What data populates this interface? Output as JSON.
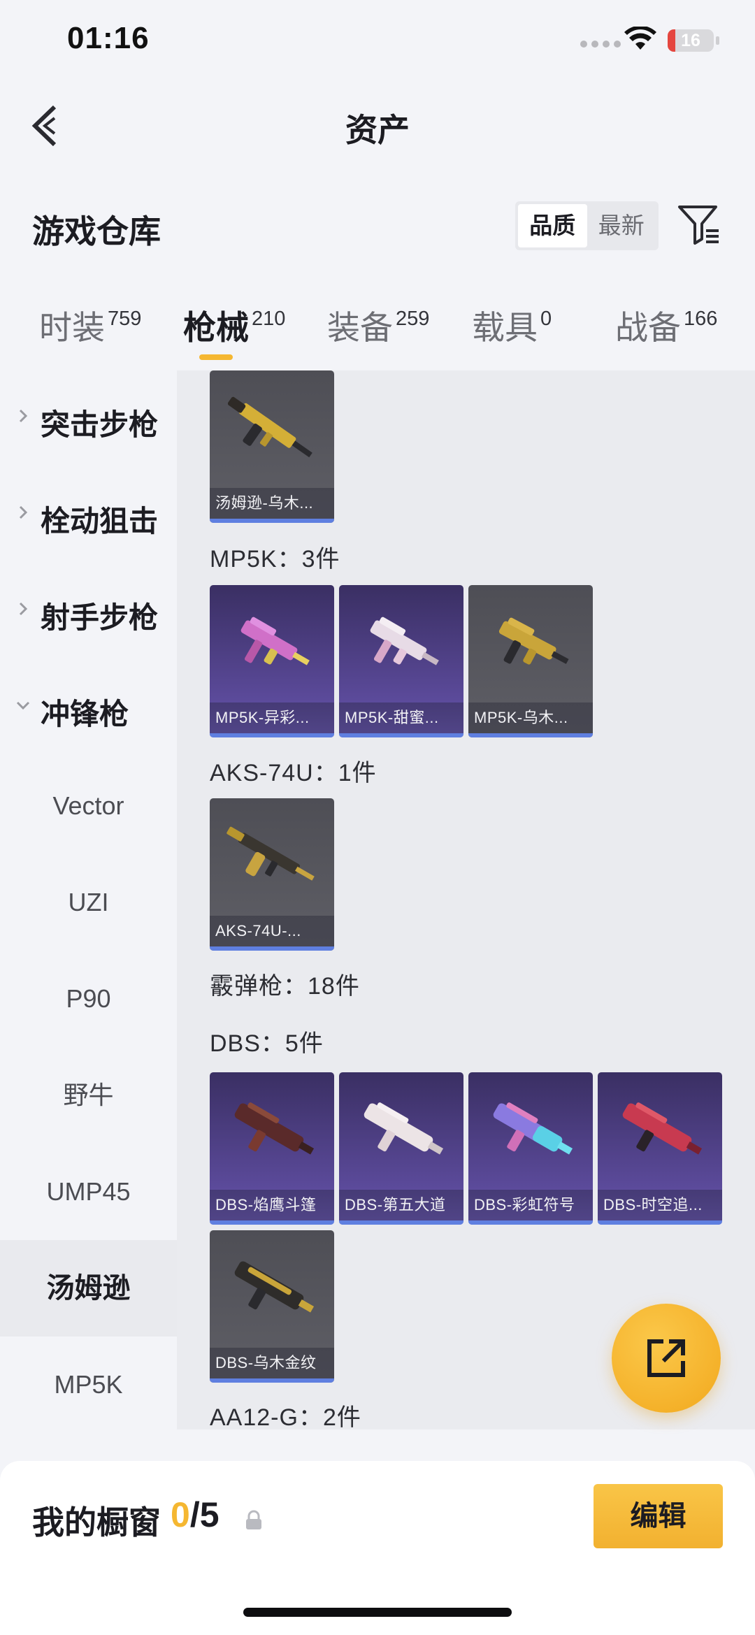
{
  "status_bar": {
    "time": "01:16",
    "battery": "16",
    "battery_level": 0.16,
    "battery_color": "#e5463f"
  },
  "nav": {
    "title": "资产"
  },
  "header": {
    "title": "游戏仓库",
    "sort_options": [
      "品质",
      "最新"
    ],
    "active_sort": "品质"
  },
  "category_tabs": [
    {
      "label": "时装",
      "count": "759",
      "active": false
    },
    {
      "label": "枪械",
      "count": "210",
      "active": true
    },
    {
      "label": "装备",
      "count": "259",
      "active": false
    },
    {
      "label": "载具",
      "count": "0",
      "active": false
    },
    {
      "label": "战备",
      "count": "166",
      "active": false
    }
  ],
  "sidebar": {
    "groups": [
      {
        "label": "突击步枪",
        "expanded": false
      },
      {
        "label": "栓动狙击",
        "expanded": false
      },
      {
        "label": "射手步枪",
        "expanded": false
      },
      {
        "label": "冲锋枪",
        "expanded": true
      }
    ],
    "sub_items": [
      "Vector",
      "UZI",
      "P90",
      "野牛",
      "UMP45",
      "汤姆逊",
      "MP5K"
    ],
    "selected_sub_item": "汤姆逊"
  },
  "content": {
    "sections": [
      {
        "label": "",
        "items": [
          {
            "name": "汤姆逊-乌木...",
            "tint": "gray"
          }
        ]
      },
      {
        "label": "MP5K：3件",
        "items": [
          {
            "name": "MP5K-异彩...",
            "tint": "purple"
          },
          {
            "name": "MP5K-甜蜜...",
            "tint": "purple"
          },
          {
            "name": "MP5K-乌木...",
            "tint": "gray"
          }
        ]
      },
      {
        "label": "AKS-74U：1件",
        "items": [
          {
            "name": "AKS-74U-...",
            "tint": "gray"
          }
        ]
      },
      {
        "label": "霰弹枪：18件",
        "items": []
      },
      {
        "label": "DBS：5件",
        "items": [
          {
            "name": "DBS-焰鹰斗篷",
            "tint": "purple"
          },
          {
            "name": "DBS-第五大道",
            "tint": "purple"
          },
          {
            "name": "DBS-彩虹符号",
            "tint": "purple"
          },
          {
            "name": "DBS-时空追...",
            "tint": "purple"
          },
          {
            "name": "DBS-乌木金纹",
            "tint": "gray"
          }
        ]
      },
      {
        "label": "AA12-G：2件",
        "items": []
      }
    ]
  },
  "showcase": {
    "label": "我的橱窗",
    "current": "0",
    "total": "/5",
    "edit_label": "编辑"
  },
  "colors": {
    "accent": "#f5b731",
    "rarity_bar": "#5f7fe0"
  }
}
